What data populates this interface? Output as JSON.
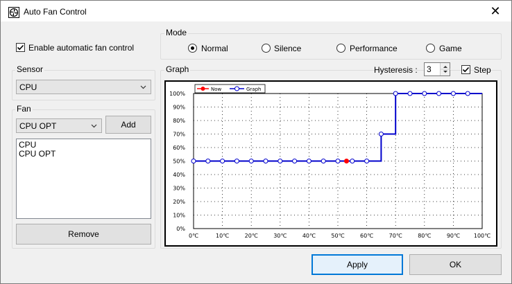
{
  "window": {
    "title": "Auto Fan Control",
    "close_glyph": "✕"
  },
  "auto_control": {
    "label": "Enable automatic fan control",
    "checked": true
  },
  "mode": {
    "label": "Mode",
    "options": [
      "Normal",
      "Silence",
      "Performance",
      "Game"
    ],
    "selected": 0
  },
  "sensor": {
    "label": "Sensor",
    "value": "CPU"
  },
  "fan": {
    "label": "Fan",
    "combo_value": "CPU OPT",
    "add_label": "Add",
    "list": [
      "CPU",
      "CPU OPT"
    ],
    "remove_label": "Remove"
  },
  "graph": {
    "label": "Graph",
    "hysteresis_label": "Hysteresis :",
    "hysteresis_value": "3",
    "step_label": "Step",
    "step_checked": true
  },
  "buttons": {
    "apply": "Apply",
    "ok": "OK"
  },
  "chart_data": {
    "type": "line",
    "legend": [
      "Now",
      "Graph"
    ],
    "xticks": [
      "0℃",
      "10℃",
      "20℃",
      "30℃",
      "40℃",
      "50℃",
      "60℃",
      "70℃",
      "80℃",
      "90℃",
      "100℃"
    ],
    "yticks": [
      "0%",
      "10%",
      "20%",
      "30%",
      "40%",
      "50%",
      "60%",
      "70%",
      "80%",
      "90%",
      "100%"
    ],
    "xlim": [
      0,
      100
    ],
    "ylim": [
      0,
      100
    ],
    "step": true,
    "series": [
      {
        "name": "Graph",
        "color": "#0000cc",
        "points": [
          [
            0,
            50
          ],
          [
            5,
            50
          ],
          [
            10,
            50
          ],
          [
            15,
            50
          ],
          [
            20,
            50
          ],
          [
            25,
            50
          ],
          [
            30,
            50
          ],
          [
            35,
            50
          ],
          [
            40,
            50
          ],
          [
            45,
            50
          ],
          [
            50,
            50
          ],
          [
            55,
            50
          ],
          [
            60,
            50
          ],
          [
            65,
            70
          ],
          [
            70,
            100
          ],
          [
            75,
            100
          ],
          [
            80,
            100
          ],
          [
            85,
            100
          ],
          [
            90,
            100
          ],
          [
            95,
            100
          ]
        ]
      },
      {
        "name": "Now",
        "color": "#ff0000",
        "points": [
          [
            53,
            50
          ]
        ]
      }
    ]
  }
}
